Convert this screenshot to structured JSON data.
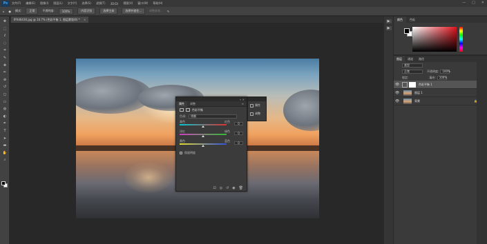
{
  "menubar": {
    "logo": "Ps",
    "items": [
      "文件(F)",
      "编辑(E)",
      "图像(I)",
      "图层(L)",
      "文字(Y)",
      "选择(S)",
      "滤镜(T)",
      "3D(D)",
      "视图(V)",
      "窗口(W)",
      "帮助(H)"
    ],
    "controls": [
      "—",
      "□",
      "✕"
    ]
  },
  "options_bar": {
    "mode_label": "模式:",
    "mode_value": "正常",
    "opacity_label": "不透明度:",
    "opacity_value": "100%",
    "button1": "内容识别",
    "button2": "选择主体",
    "button3": "选择并遮住...",
    "dim_text": "调整画笔..."
  },
  "document_tab": {
    "title": "IPX46430.jpg @ 16.7% (色彩平衡 1, 图层蒙版/8) *",
    "close": "×"
  },
  "tool_icons": [
    "move-icon",
    "marquee-icon",
    "lasso-icon",
    "quick-select-icon",
    "crop-icon",
    "eyedropper-icon",
    "healing-icon",
    "brush-icon",
    "stamp-icon",
    "history-brush-icon",
    "eraser-icon",
    "gradient-icon",
    "blur-icon",
    "dodge-icon",
    "pen-icon",
    "type-icon",
    "path-select-icon",
    "shape-icon",
    "hand-icon",
    "zoom-icon"
  ],
  "tool_glyphs": [
    "✥",
    "⬚",
    "ℓ",
    "◌",
    "⌗",
    "✎",
    "✚",
    "✏",
    "⊕",
    "↺",
    "◻",
    "▭",
    "◍",
    "◐",
    "✒",
    "T",
    "➤",
    "▬",
    "✋",
    "⌕"
  ],
  "properties_panel": {
    "tab_active": "属性",
    "tab_2": "调整",
    "menu_icon": "≡",
    "top_controls": "» ✕",
    "heading": "色彩平衡",
    "tone_label": "色调:",
    "tone_value": "阴影",
    "sliders": [
      {
        "left_label": "青色",
        "right_label": "红色",
        "value": "0",
        "position": 0.5,
        "gradient": [
          "#00c8d0",
          "#e03030"
        ]
      },
      {
        "left_label": "洋红",
        "right_label": "绿色",
        "value": "0",
        "position": 0.5,
        "gradient": [
          "#d040c0",
          "#30c030"
        ]
      },
      {
        "left_label": "黄色",
        "right_label": "蓝色",
        "value": "0",
        "position": 0.5,
        "gradient": [
          "#e8e030",
          "#3050e0"
        ]
      }
    ],
    "preserve_label": "保留明度",
    "footer_icons": [
      "clip-icon",
      "visibility-icon",
      "reset-icon",
      "eye-icon",
      "trash-icon"
    ],
    "footer_glyphs": [
      "⊡",
      "◎",
      "↺",
      "◉",
      "🗑"
    ]
  },
  "mini_panel": {
    "item1": "属性",
    "item2": "调整"
  },
  "collapsed_strip": {
    "btn1": "▶",
    "btn2": "▶"
  },
  "color_panel": {
    "tab_active": "颜色",
    "tab_2": "色板"
  },
  "layers_panel": {
    "tab_active": "图层",
    "tab_2": "通道",
    "tab_3": "路径",
    "kind_value": "类型",
    "blend_value": "正常",
    "opacity_label": "不透明度:",
    "opacity_value": "100%",
    "lock_label": "锁定:",
    "fill_label": "填充:",
    "fill_value": "100%",
    "layers": [
      {
        "name": "色彩平衡 1",
        "selected": true,
        "type": "adjustment",
        "lock": ""
      },
      {
        "name": "图层 1",
        "selected": false,
        "type": "image",
        "lock": ""
      },
      {
        "name": "背景",
        "selected": false,
        "type": "image",
        "lock": "🔒"
      }
    ]
  },
  "colors": {
    "accent": "#31a8ff",
    "panel_bg": "#3b3b3b",
    "workspace": "#282828"
  }
}
